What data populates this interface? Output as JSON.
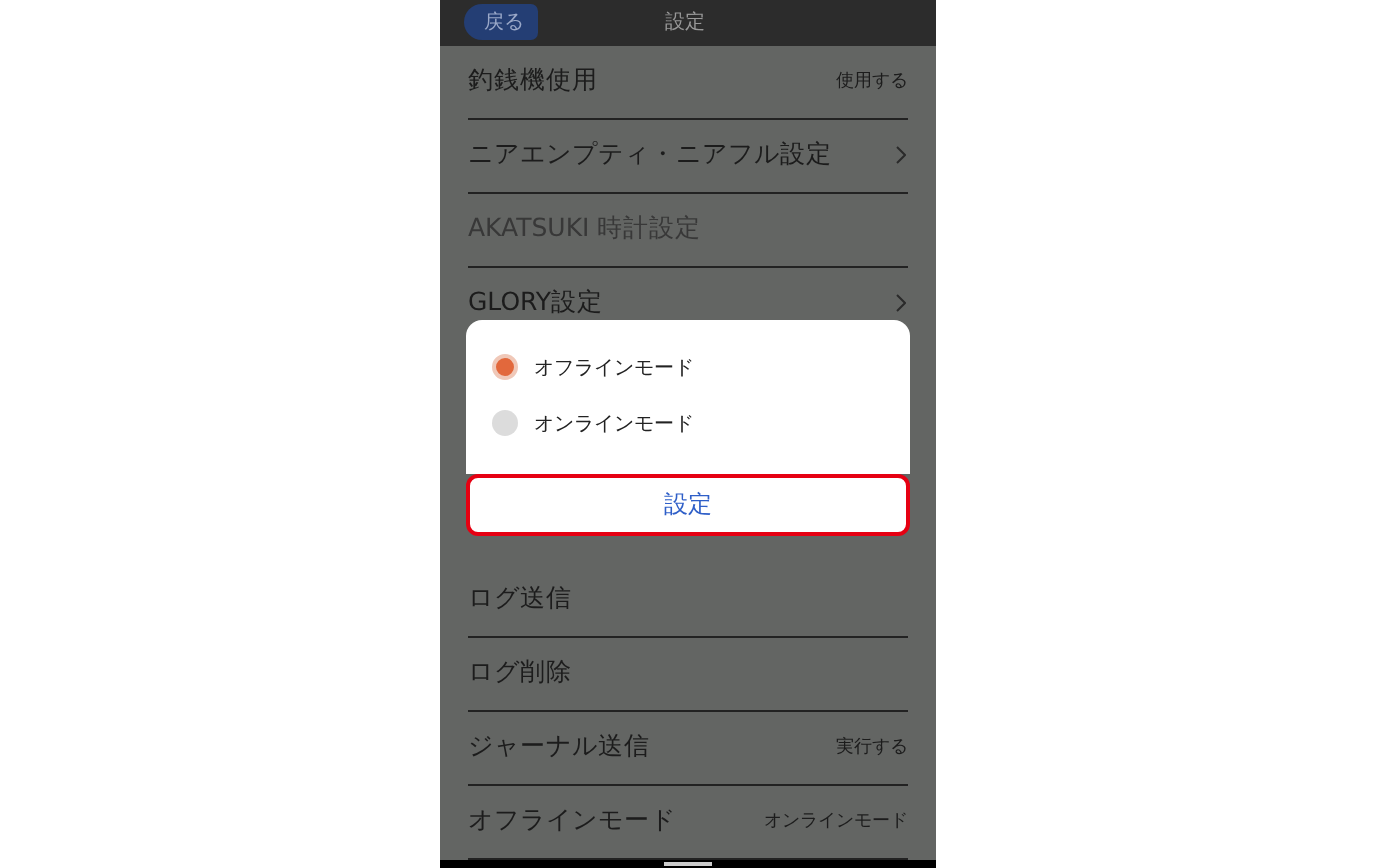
{
  "header": {
    "back_button": "戻る",
    "title": "設定"
  },
  "settings": [
    {
      "label": "釣銭機使用",
      "value": "使用する",
      "kind": "value",
      "disabled": false
    },
    {
      "label": "ニアエンプティ・ニアフル設定",
      "kind": "link",
      "disabled": false
    },
    {
      "label": "AKATSUKI 時計設定",
      "kind": "plain",
      "disabled": true
    },
    {
      "label": "GLORY設定",
      "kind": "link",
      "disabled": false
    },
    {
      "kind": "covered"
    },
    {
      "label": "ログ送信",
      "kind": "plain",
      "disabled": false
    },
    {
      "label": "ログ削除",
      "kind": "plain",
      "disabled": false
    },
    {
      "label": "ジャーナル送信",
      "value": "実行する",
      "kind": "value",
      "disabled": false
    },
    {
      "label": "オフラインモード",
      "value": "オンラインモード",
      "kind": "value",
      "disabled": false
    }
  ],
  "dialog": {
    "options": [
      {
        "label": "オフラインモード",
        "selected": true
      },
      {
        "label": "オンラインモード",
        "selected": false
      }
    ],
    "button": "設定"
  }
}
